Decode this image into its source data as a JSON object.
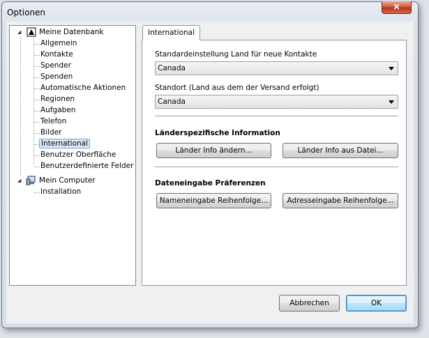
{
  "window": {
    "title": "Optionen",
    "close_label": "✕"
  },
  "tree": {
    "root1": {
      "label": "Meine Datenbank",
      "icon": "database-icon"
    },
    "children1": [
      {
        "label": "Allgemein"
      },
      {
        "label": "Kontakte"
      },
      {
        "label": "Spender"
      },
      {
        "label": "Spenden"
      },
      {
        "label": "Automatische Aktionen"
      },
      {
        "label": "Regionen"
      },
      {
        "label": "Aufgaben"
      },
      {
        "label": "Telefon"
      },
      {
        "label": "Bilder"
      },
      {
        "label": "International",
        "selected": true
      },
      {
        "label": "Benutzer Oberfläche"
      },
      {
        "label": "Benutzerdefinierte Felder"
      }
    ],
    "root2": {
      "label": "Mein Computer",
      "icon": "computer-icon"
    },
    "children2": [
      {
        "label": "Installation"
      }
    ]
  },
  "tab": {
    "label": "International"
  },
  "settings": {
    "default_country_label": "Standardeinstellung Land für neue Kontakte",
    "default_country_value": "Canada",
    "location_label": "Standort (Land aus dem der Versand erfolgt)",
    "location_value": "Canada",
    "country_info_heading": "Länderspezifische Information",
    "change_info_button": "Länder Info ändern...",
    "info_from_file_button": "Länder Info aus Datei...",
    "data_entry_heading": "Dateneingabe Präferenzen",
    "name_order_button": "Nameneingabe Reihenfolge...",
    "address_order_button": "Adresseingabe Reihenfolge..."
  },
  "footer": {
    "cancel": "Abbrechen",
    "ok": "OK"
  }
}
